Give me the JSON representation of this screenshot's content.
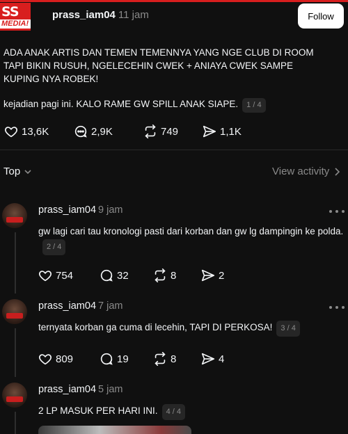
{
  "main_post": {
    "avatar_text_top": "SS",
    "avatar_text_bottom": "MEDIA!",
    "username": "prass_iam04",
    "time": "11 jam",
    "follow_label": "Follow",
    "text_line1": "ADA ANAK ARTIS DAN TEMEN TEMENNYA YANG NGE CLUB DI ROOM TAPI BIKIN RUSUH, NGELECEHIN CWEK + ANIAYA CWEK SAMPE KUPING NYA ROBEK!",
    "text_line2": "kejadian pagi ini. KALO RAME GW SPILL ANAK SIAPE.",
    "page_badge": "1 / 4",
    "likes": "13,6K",
    "comments": "2,9K",
    "reposts": "749",
    "shares": "1,1K"
  },
  "replies_header": {
    "sort_label": "Top",
    "view_activity_label": "View activity"
  },
  "replies": [
    {
      "username": "prass_iam04",
      "time": "9 jam",
      "text": "gw lagi cari tau kronologi pasti dari korban dan gw lg dampingin ke polda.",
      "badge": "2 / 4",
      "likes": "754",
      "comments": "32",
      "reposts": "8",
      "shares": "2"
    },
    {
      "username": "prass_iam04",
      "time": "7 jam",
      "text": "ternyata korban ga cuma di lecehin, TAPI DI PERKOSA!",
      "badge": "3 / 4",
      "likes": "809",
      "comments": "19",
      "reposts": "8",
      "shares": "4"
    },
    {
      "username": "prass_iam04",
      "time": "5 jam",
      "text": "2 LP MASUK PER HARI INI.",
      "badge": "4 / 4"
    }
  ],
  "colors": {
    "background": "#101010",
    "text": "#f3f5f7",
    "muted": "#8a8a8a",
    "accent_red": "#d81e1e"
  }
}
